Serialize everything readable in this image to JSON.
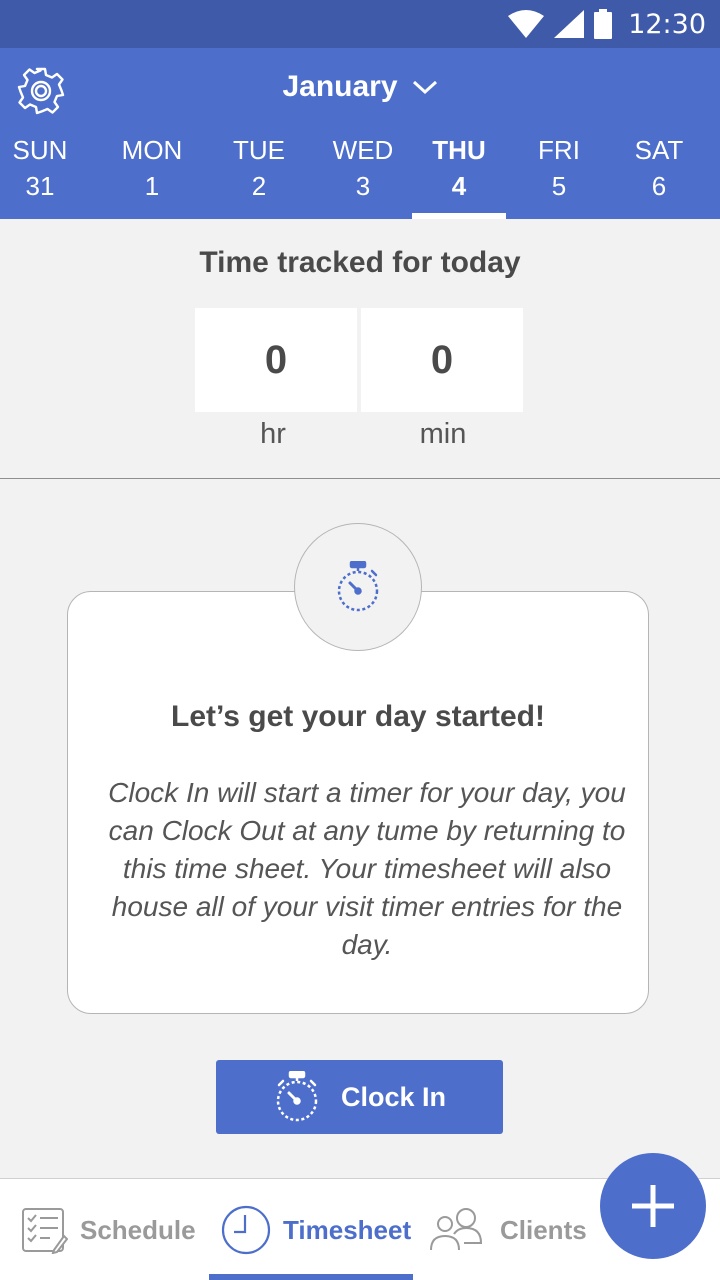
{
  "status_bar": {
    "time": "12:30",
    "icons": [
      "wifi-icon",
      "signal-icon",
      "battery-icon"
    ]
  },
  "header": {
    "settings_icon": "gear-icon",
    "month": "January",
    "month_dropdown_icon": "chevron-down-icon",
    "days": [
      {
        "name": "SUN",
        "num": "31"
      },
      {
        "name": "MON",
        "num": "1"
      },
      {
        "name": "TUE",
        "num": "2"
      },
      {
        "name": "WED",
        "num": "3"
      },
      {
        "name": "THU",
        "num": "4",
        "selected": true
      },
      {
        "name": "FRI",
        "num": "5"
      },
      {
        "name": "SAT",
        "num": "6"
      }
    ]
  },
  "tracked": {
    "title": "Time tracked for today",
    "hours": "0",
    "hours_unit": "hr",
    "minutes": "0",
    "minutes_unit": "min"
  },
  "card": {
    "icon": "stopwatch-icon",
    "title": "Let’s get your day started!",
    "body": "Clock In will start a timer for your day, you can Clock Out at any tume by returning to this time sheet. Your timesheet will also house all of your visit timer entries for the day."
  },
  "clock_in": {
    "label": "Clock In",
    "icon": "stopwatch-icon"
  },
  "bottom_nav": {
    "items": [
      {
        "label": "Schedule",
        "icon": "checklist-icon"
      },
      {
        "label": "Timesheet",
        "icon": "clock-icon",
        "active": true
      },
      {
        "label": "Clients",
        "icon": "people-icon"
      }
    ]
  },
  "fab": {
    "icon": "plus-icon"
  },
  "colors": {
    "primary": "#4d6fcb",
    "status_bar": "#3f5aa8",
    "background": "#f2f2f2",
    "inactive_nav": "#9a9a9a"
  }
}
